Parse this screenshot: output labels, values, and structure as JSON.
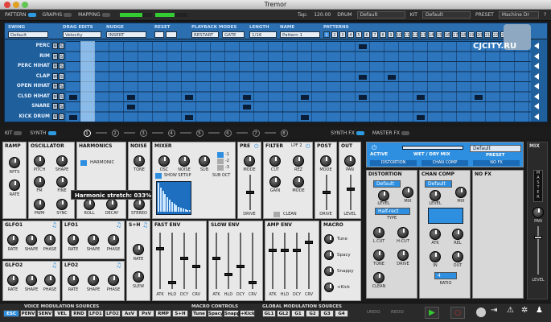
{
  "window": {
    "title": "Tremor"
  },
  "topbar": {
    "pattern": "PATTERN",
    "graphs": "GRAPHS",
    "mapping": "MAPPING",
    "tap": "Tap:",
    "tempo": "120.00",
    "drum_label": "DRUM",
    "drum_value": "Default",
    "kit_label": "KIT",
    "kit_value": "Default",
    "preset_label": "PRESET",
    "preset_value": "Machine Dr"
  },
  "seq_header": {
    "swing": "SWING",
    "swing_val": "Default",
    "drag": "DRAG EDITS",
    "drag_val": "Velocity",
    "nudge": "NUDGE",
    "nudge_val": "INSERT",
    "reset": "RESET",
    "playback": "PLAYBACK MODES",
    "restart": "RESTART",
    "gate": "GATE",
    "length": "LENGTH",
    "length_val": "1/16",
    "name": "NAME",
    "name_val": "Pattern 1",
    "patterns": "PATTERNS"
  },
  "patterns": [
    "1",
    "2",
    "3",
    "4",
    "5",
    "6",
    "7",
    "8",
    "9",
    "10",
    "11",
    "12",
    "13",
    "14",
    "15",
    "16",
    "17",
    "18",
    "19",
    "20",
    "21",
    "22",
    "23",
    "24"
  ],
  "rows": [
    "PERC",
    "RIM",
    "PERC HIHAT",
    "CLAP",
    "OPEN HIHAT",
    "CLSD HIHAT",
    "SNARE",
    "KICK DRUM"
  ],
  "ms": {
    "m": "M",
    "s": "S"
  },
  "watermark": "CJCITY.RU",
  "tabs": {
    "kit": "KIT",
    "synth": "SYNTH",
    "nums": [
      "1",
      "2",
      "3",
      "4",
      "5",
      "6",
      "7",
      "8"
    ],
    "synthfx": "SYNTH FX",
    "masterfx": "MASTER FX"
  },
  "ramp": {
    "title": "RAMP",
    "rpts": "RPTS",
    "rate": "RATE"
  },
  "osc": {
    "title": "OSCILLATOR",
    "pitch": "PITCH",
    "shape": "SHAPE",
    "fm": "FM",
    "fine": "FINE",
    "pwm": "PWM",
    "sync": "SYNC"
  },
  "harm": {
    "title": "HARMONICS",
    "harmonic": "HARMONIC",
    "roll": "ROLL",
    "decay": "DECAY"
  },
  "noise": {
    "title": "NOISE",
    "tone": "TONE",
    "stereo": "STEREO"
  },
  "mixer": {
    "title": "MIXER",
    "osc": "OSC",
    "noise": "NOISE",
    "sub": "SUB",
    "show_setup": "SHOW SETUP",
    "sub_oct": "SUB OCT",
    "o1": "-1",
    "o2": "-2",
    "o3": "-3"
  },
  "pre": {
    "title": "PRE",
    "mode": "MODE",
    "drive": "DRIVE"
  },
  "filter": {
    "title": "FILTER",
    "type": "LPF 2",
    "cut": "CUT",
    "rez": "REZ",
    "gain": "GAIN",
    "mode": "MODE",
    "clean": "CLEAN"
  },
  "post": {
    "title": "POST",
    "mode": "MODE",
    "drive": "DRIVE"
  },
  "out": {
    "title": "OUT",
    "pan": "PAN",
    "level": "LEVEL"
  },
  "tooltip": "Harmonic stretch: 033%",
  "glfo1": {
    "title": "GLFO1",
    "rate": "RATE",
    "shape": "SHAPE",
    "phase": "PHASE"
  },
  "lfo1": {
    "title": "LFO1",
    "rate": "RATE",
    "shape": "SHAPE",
    "phase": "PHASE"
  },
  "glfo2": {
    "title": "GLFO2",
    "rate": "RATE",
    "shape": "SHAPE",
    "phase": "PHASE"
  },
  "lfo2": {
    "title": "LFO2",
    "rate": "RATE",
    "shape": "SHAPE",
    "phase": "PHASE"
  },
  "sh": {
    "title": "S+H",
    "rate": "RATE",
    "slew": "SLEW"
  },
  "fastenv": {
    "title": "FAST ENV",
    "labels": [
      "ATK",
      "HLD",
      "DCY",
      "CRV"
    ]
  },
  "slowenv": {
    "title": "SLOW ENV",
    "labels": [
      "ATK",
      "HLD",
      "DCY",
      "CRV"
    ]
  },
  "ampenv": {
    "title": "AMP ENV",
    "labels": [
      "ATK",
      "HLD",
      "DCY",
      "CRV"
    ]
  },
  "macro": {
    "title": "MACRO",
    "items": [
      "Tune",
      "Spacy",
      "Snappy",
      "+Kick"
    ]
  },
  "fx": {
    "active": "ACTIVE",
    "wetdry": "WET / DRY MIX",
    "preset_val": "Default",
    "preset": "PRESET",
    "distortion": "DISTORTION",
    "chancomp": "CHAN COMP",
    "nofx": "NO FX"
  },
  "dist": {
    "title": "DISTORTION",
    "preset": "Default",
    "level": "LEVEL",
    "mix": "MIX",
    "type_val": "Half-rect",
    "type": "TYPE",
    "lcut": "L CUT",
    "hcut": "H-CUT",
    "tone": "TONE",
    "drive": "DRIVE",
    "clean": "CLEAN"
  },
  "comp": {
    "title": "CHAN COMP",
    "preset": "Default",
    "level": "LEVEL",
    "mix": "MIX",
    "atk": "ATK",
    "rel": "REL",
    "in": "IN",
    "out": "OUT",
    "ratio_val": "4",
    "ratio": "RATIO"
  },
  "nofx": {
    "title": "NO FX"
  },
  "mix": {
    "title": "MIX",
    "pan": "PAN",
    "level": "LEVEL",
    "letters": [
      "M",
      "A",
      "S",
      "T",
      "E",
      "R"
    ]
  },
  "bottom": {
    "voice": "VOICE MODULATION SOURCES",
    "macro": "MACRO CONTROLS",
    "global": "GLOBAL MODULATION SOURCES",
    "undo": "UNDO",
    "redo": "REDO",
    "voice_items": [
      "ESC",
      "PENV",
      "SENV",
      "VEL",
      "RND",
      "LFO1",
      "LFO2",
      "AxV",
      "PxV",
      "RMP",
      "S+H"
    ],
    "macro_items": [
      "Tune",
      "Spacy",
      "Snappy",
      "+Kick"
    ],
    "global_items": [
      "GL1",
      "GL2",
      "G1",
      "G2",
      "G3",
      "G4"
    ]
  }
}
